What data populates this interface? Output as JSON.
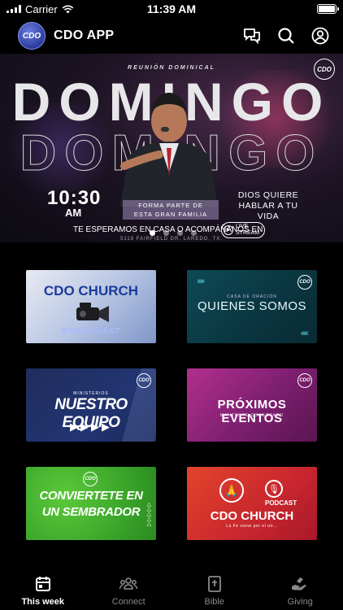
{
  "status_bar": {
    "carrier": "Carrier",
    "time": "11:39 AM"
  },
  "header": {
    "title": "CDO APP",
    "logo_text": "CDO",
    "icons": [
      "chat-icon",
      "search-icon",
      "profile-icon"
    ]
  },
  "hero": {
    "kicker": "REUNIÓN DOMINICAL",
    "word": "DOMINGO",
    "time": "10:30",
    "ampm": "AM",
    "family_line1": "FORMA PARTE DE",
    "family_line2": "ESTA GRAN FAMILIA",
    "dios_line1": "DIOS QUIERE",
    "dios_line2": "HABLAR A TU VIDA",
    "invite": "TE ESPERAMOS EN CASA O ACOMPÁÑANOS EN",
    "live_line1": "LIVE",
    "live_line2": "STREAM",
    "address": "5119 FAIRFIELD DR. LAREDO, TX.",
    "slides": 4,
    "active_slide": 1
  },
  "tiles": {
    "t1": {
      "title": "CDO CHURCH",
      "subtitle": "BROADCAST"
    },
    "t2": {
      "kicker": "CASA DE ORACIÓN",
      "title": "QUIENES SOMOS"
    },
    "t3": {
      "kicker": "MINISTERIOS",
      "title": "NUESTRO EQUIPO"
    },
    "t4": {
      "title": "PRÓXIMOS EVENTOS",
      "subtitle": "MANTENTE CONECTADO"
    },
    "t5": {
      "title_line1": "CONVIERTETE EN",
      "title_line2": "UN SEMBRADOR"
    },
    "t6": {
      "podcast": "PODCAST",
      "title": "CDO CHURCH",
      "subtitle": "La Fe viene por el oír..."
    }
  },
  "tab_bar": {
    "tabs": [
      {
        "label": "This week",
        "icon": "calendar-icon",
        "active": true
      },
      {
        "label": "Connect",
        "icon": "people-icon",
        "active": false
      },
      {
        "label": "Bible",
        "icon": "bible-icon",
        "active": false
      },
      {
        "label": "Giving",
        "icon": "giving-icon",
        "active": false
      }
    ]
  }
}
